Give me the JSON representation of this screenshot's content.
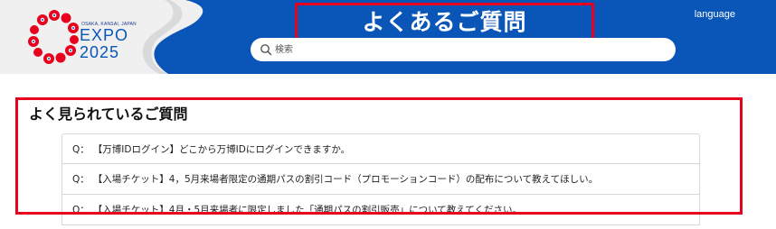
{
  "logo": {
    "tagline": "OSAKA, KANSAI, JAPAN",
    "expo": "EXPO",
    "year": "2025"
  },
  "header": {
    "title": "よくあるご質問",
    "language_label": "language",
    "colors": {
      "primary_blue": "#0a56b8",
      "header_bg": "#f0f0f0",
      "highlight_red": "#e8001c"
    }
  },
  "search": {
    "placeholder": "検索",
    "value": "",
    "icon": "search-icon"
  },
  "faq": {
    "heading": "よく見られているご質問",
    "items": [
      {
        "prefix": "Q：",
        "text": "【万博IDログイン】どこから万博IDにログインできますか。"
      },
      {
        "prefix": "Q：",
        "text": "【入場チケット】4，5月来場者限定の通期パスの割引コード（プロモーションコード）の配布について教えてほしい。"
      },
      {
        "prefix": "Q：",
        "text": "【入場チケット】4月・5月来場者に限定しました「通期パスの割引販売」について教えてください。"
      }
    ]
  }
}
